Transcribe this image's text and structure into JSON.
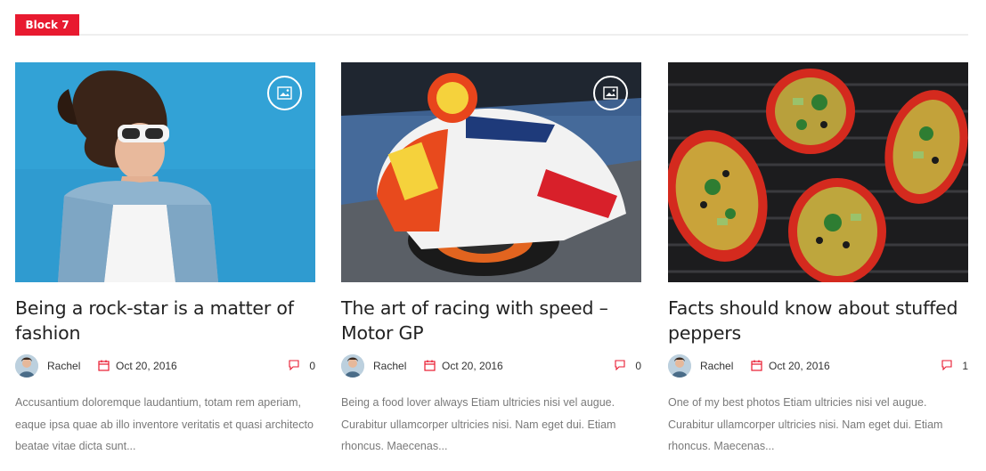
{
  "block": {
    "label": "Block 7"
  },
  "posts": [
    {
      "title": "Being a rock-star is a matter of fashion",
      "author": "Rachel",
      "date": "Oct 20, 2016",
      "comments": "0",
      "excerpt": "Accusantium doloremque laudantium, totam rem aperiam, eaque ipsa quae ab illo inventore veritatis et quasi architecto beatae vitae dicta sunt...",
      "image_icon": "image-icon"
    },
    {
      "title": "The art of racing with speed – Motor GP",
      "author": "Rachel",
      "date": "Oct 20, 2016",
      "comments": "0",
      "excerpt": "Being a food lover always Etiam ultricies nisi vel augue. Curabitur ullamcorper ultricies nisi. Nam eget dui. Etiam rhoncus. Maecenas...",
      "image_icon": "image-icon"
    },
    {
      "title": "Facts should know about stuffed peppers",
      "author": "Rachel",
      "date": "Oct 20, 2016",
      "comments": "1",
      "excerpt": "One of my best photos Etiam ultricies nisi vel augue. Curabitur ullamcorper ultricies nisi. Nam eget dui. Etiam rhoncus. Maecenas..."
    }
  ],
  "colors": {
    "accent": "#e81a30",
    "text": "#222222",
    "muted": "#7a7a7a"
  }
}
